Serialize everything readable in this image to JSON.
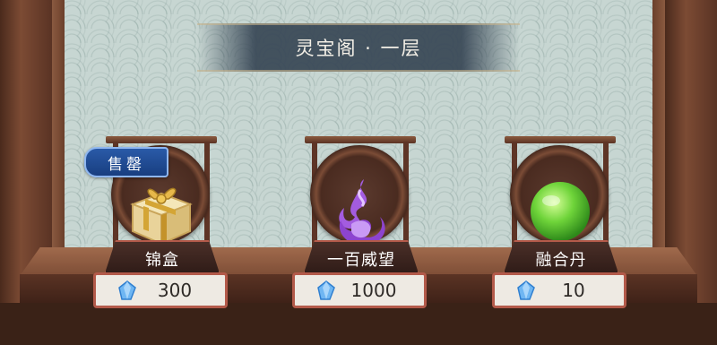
{
  "shop": {
    "title": "灵宝阁 · 一层"
  },
  "currency_icon": "blue-crystal-icon",
  "items": [
    {
      "name": "锦盒",
      "price": "300",
      "badge": "售罄",
      "icon": "gift-box-icon"
    },
    {
      "name": "一百威望",
      "price": "1000",
      "badge": "",
      "icon": "purple-flame-icon"
    },
    {
      "name": "融合丹",
      "price": "10",
      "badge": "",
      "icon": "green-pill-icon"
    }
  ],
  "colors": {
    "price_border": "#b35a4a",
    "badge_bg": "#1e4a94",
    "banner_bg": "#374655"
  }
}
